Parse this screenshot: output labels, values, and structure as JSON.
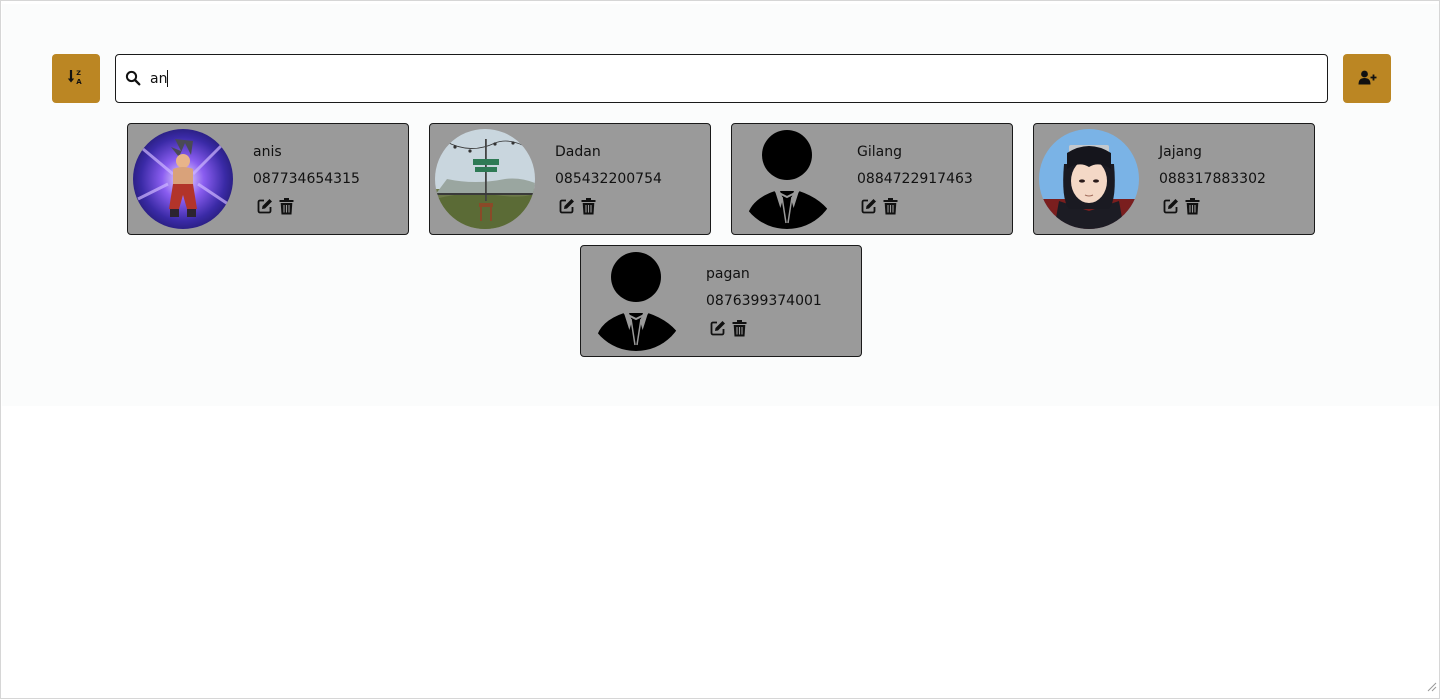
{
  "toolbar": {
    "sort_icon": "sort-alpha-down-icon",
    "add_icon": "user-plus-icon",
    "accent_color": "#bb8623"
  },
  "search": {
    "value": "an",
    "icon": "search-icon"
  },
  "contacts": [
    {
      "name": "anis",
      "phone": "087734654315",
      "avatar": "anime-warrior-photo"
    },
    {
      "name": "Dadan",
      "phone": "085432200754",
      "avatar": "outdoor-landscape-photo"
    },
    {
      "name": "Gilang",
      "phone": "0884722917463",
      "avatar": "default-person-silhouette"
    },
    {
      "name": "Jajang",
      "phone": "088317883302",
      "avatar": "anime-ninja-photo"
    },
    {
      "name": "pagan",
      "phone": "0876399374001",
      "avatar": "default-person-silhouette"
    }
  ],
  "card_color": "#9a9a9a"
}
